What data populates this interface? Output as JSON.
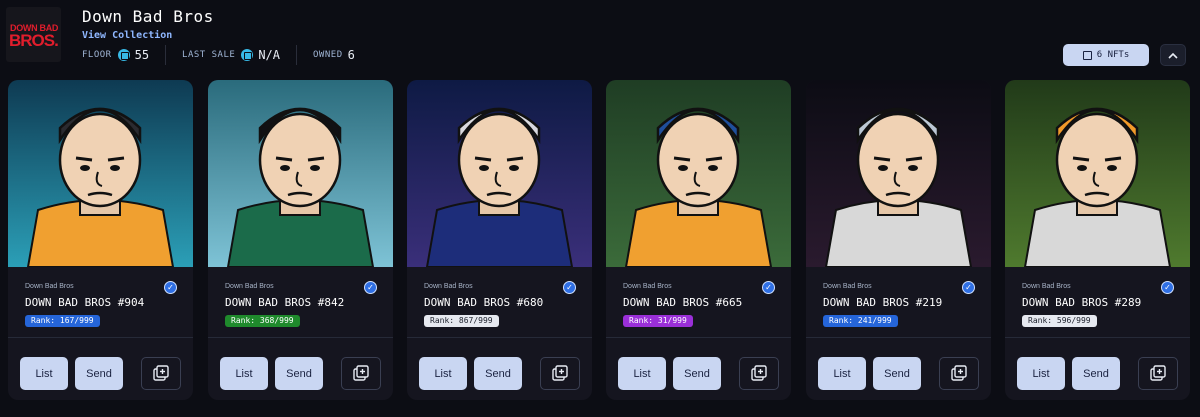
{
  "collection": {
    "logo_line1": "DOWN BAD",
    "logo_line2": "BROS.",
    "title": "Down Bad Bros",
    "view_link": "View Collection",
    "floor_label": "FLOOR",
    "floor_value": "55",
    "last_sale_label": "LAST SALE",
    "last_sale_value": "N/A",
    "owned_label": "OWNED",
    "owned_value": "6"
  },
  "controls": {
    "nfts_label": "6 NFTs",
    "collapse_icon": "chevron-up-icon"
  },
  "colors": {
    "accent": "#c9d6f2",
    "sol": "#38b9e6",
    "verified": "#2f6fe4"
  },
  "nfts": [
    {
      "collection": "Down Bad Bros",
      "name": "DOWN BAD BROS #904",
      "rank": "Rank: 167/999",
      "rank_color": "#2565d9",
      "rank_text_color": "#ffffff",
      "list_label": "List",
      "send_label": "Send"
    },
    {
      "collection": "Down Bad Bros",
      "name": "DOWN BAD BROS #842",
      "rank": "Rank: 368/999",
      "rank_color": "#1f8a2c",
      "rank_text_color": "#ffffff",
      "list_label": "List",
      "send_label": "Send"
    },
    {
      "collection": "Down Bad Bros",
      "name": "DOWN BAD BROS #680",
      "rank": "Rank: 867/999",
      "rank_color": "#e6e9f0",
      "rank_text_color": "#20242f",
      "list_label": "List",
      "send_label": "Send"
    },
    {
      "collection": "Down Bad Bros",
      "name": "DOWN BAD BROS #665",
      "rank": "Rank: 31/999",
      "rank_color": "#9a2fd8",
      "rank_text_color": "#ffffff",
      "list_label": "List",
      "send_label": "Send"
    },
    {
      "collection": "Down Bad Bros",
      "name": "DOWN BAD BROS #219",
      "rank": "Rank: 241/999",
      "rank_color": "#2565d9",
      "rank_text_color": "#ffffff",
      "list_label": "List",
      "send_label": "Send"
    },
    {
      "collection": "Down Bad Bros",
      "name": "DOWN BAD BROS #289",
      "rank": "Rank: 596/999",
      "rank_color": "#e6e9f0",
      "rank_text_color": "#20242f",
      "list_label": "List",
      "send_label": "Send"
    }
  ]
}
